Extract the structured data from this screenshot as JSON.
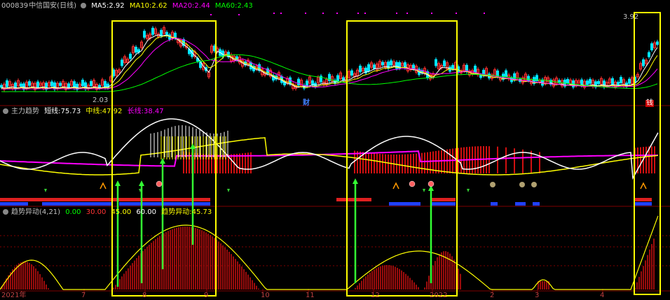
{
  "panel_main": {
    "code": "000839",
    "name": "中信国安(日线)",
    "ma": [
      {
        "label": "MA5:",
        "value": "2.92",
        "color": "#ffffff"
      },
      {
        "label": "MA10:",
        "value": "2.62",
        "color": "#ffff00"
      },
      {
        "label": "MA20:",
        "value": "2.44",
        "color": "#ff00ff"
      },
      {
        "label": "MA60:",
        "value": "2.43",
        "color": "#00ff00"
      }
    ],
    "low_price_label": "2.03",
    "high_price_label": "3.92",
    "fin_tag_1": "财",
    "fin_tag_2": "钱"
  },
  "panel_trend": {
    "title": "主力趋势",
    "short_label": "短线:",
    "short_value": "75.73",
    "mid_label": "中线:",
    "mid_value": "47.92",
    "long_label": "长线:",
    "long_value": "38.47"
  },
  "panel_abnormal": {
    "title": "趋势异动(4,21)",
    "levels": [
      "0.00",
      "30.00",
      "45.00",
      "60.00"
    ],
    "value_label": "趋势异动:",
    "value": "45.73"
  },
  "time_axis": {
    "labels": [
      "2021年",
      "7",
      "8",
      "9",
      "10",
      "11",
      "12",
      "2022",
      "2",
      "3",
      "4"
    ]
  },
  "colors": {
    "ma5": "#ffffff",
    "ma10": "#ffff00",
    "ma20": "#ff00ff",
    "ma60": "#00ff00",
    "up": "#ff3030",
    "down": "#00e5ff",
    "highlight_box": "#ffff00",
    "signal_arrow": "#33ff33",
    "grid": "#800000"
  }
}
